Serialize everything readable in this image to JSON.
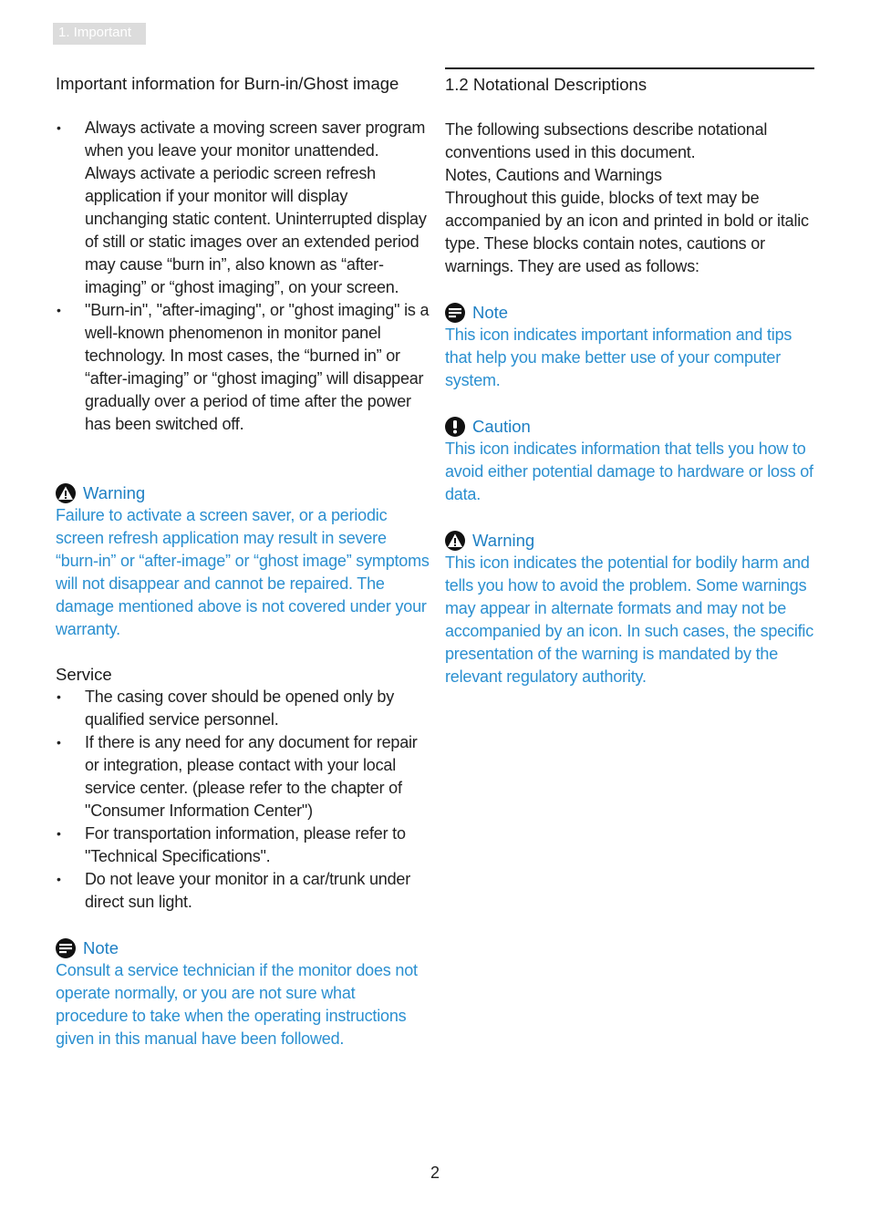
{
  "header": {
    "tab_label": "1. Important"
  },
  "left": {
    "burnin_heading": "Important information for Burn-in/Ghost image",
    "burnin_bullets": [
      "Always activate a moving screen saver program when you leave your monitor unattended. Always activate a periodic screen refresh application if your monitor will display unchanging static content. Uninterrupted display of still or static images over an extended period may cause “burn in”, also known as “after-imaging” or “ghost imaging”, on your screen.",
      "\"Burn-in\", \"after-imaging\", or \"ghost imaging\" is a well-known phenomenon in monitor panel technology. In most cases, the “burned in” or “after-imaging” or “ghost imaging” will disappear gradually over a period of time after the power has been switched off."
    ],
    "warning": {
      "title": "Warning",
      "body": "Failure to activate a screen saver, or a periodic screen refresh application may result in severe “burn-in” or “after-image” or “ghost image” symptoms will not disappear and cannot be repaired. The damage mentioned above is not covered under your warranty."
    },
    "service_heading": "Service",
    "service_bullets": [
      "The casing cover should be opened only by qualified service personnel.",
      "If there is any need for any document for repair or integration, please contact with your local service center. (please refer to the chapter of \"Consumer Information Center\")",
      "For transportation information, please refer to \"Technical Specifications\".",
      "Do not leave your monitor in a car/trunk under direct sun light."
    ],
    "note": {
      "title": "Note",
      "body": "Consult a service technician if the monitor does not operate normally, or you are not sure what procedure to take when the operating instructions given in this manual have been followed."
    }
  },
  "right": {
    "section_heading": "1.2 Notational Descriptions",
    "intro_lines": [
      "The following subsections describe notational conventions used in this document.",
      "Notes, Cautions and Warnings",
      "Throughout this guide, blocks of text may be accompanied by an icon and printed in bold or italic type. These blocks contain notes, cautions or warnings. They are used as follows:"
    ],
    "note": {
      "title": "Note",
      "body": "This icon indicates important information and tips that help you make better use of your computer system."
    },
    "caution": {
      "title": "Caution",
      "body": "This icon indicates information that tells you how to avoid either potential damage to hardware or loss of data."
    },
    "warning": {
      "title": "Warning",
      "body": "This icon indicates the potential for bodily harm and tells you how to avoid the problem. Some warnings may appear in alternate formats and may not be accompanied by an icon. In such cases, the specific presentation of the warning is mandated by the relevant regulatory authority."
    }
  },
  "footer": {
    "page_number": "2"
  },
  "colors": {
    "accent": "#2a8fd0",
    "tab_bg": "#dcdcdc",
    "text": "#222222"
  }
}
